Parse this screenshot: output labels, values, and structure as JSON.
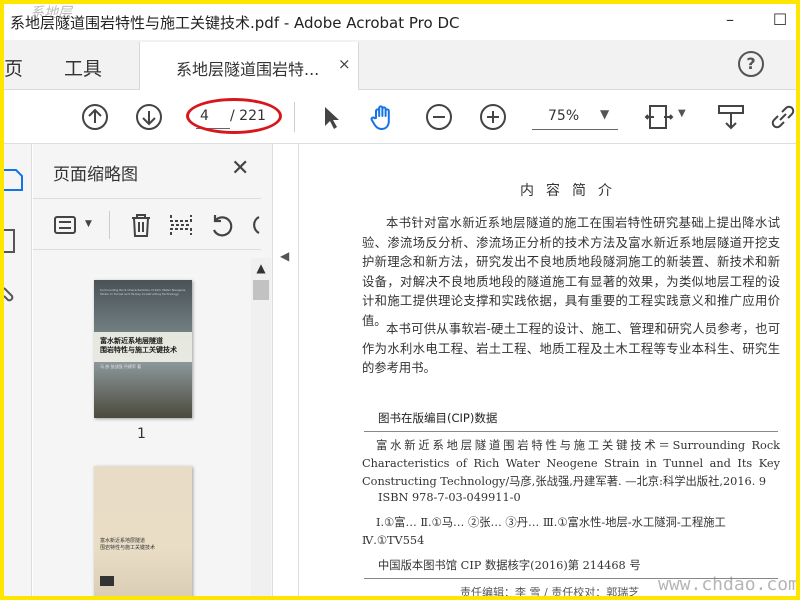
{
  "window": {
    "title": "系地层隧道围岩特性与施工关键技术.pdf - Adobe Acrobat Pro DC",
    "watermark_topleft": "系地层"
  },
  "tabs": {
    "home_partial": "页",
    "tools": "工具",
    "document": "系地层隧道围岩特...",
    "close_symbol": "×",
    "help_symbol": "?"
  },
  "toolbar": {
    "page_current": "4",
    "page_total": "/ 221",
    "zoom": "75%"
  },
  "thumbnail_panel": {
    "title": "页面缩略图",
    "close_symbol": "✕",
    "thumbs": [
      {
        "label": "1",
        "cover_title": "富水新近系地层隧道\n围岩特性与施工关键技术",
        "cover_en": "Surrounding Rock Characteristics of Rich Water Neogene Strain in Tunnel and Its Key Constructing Technology",
        "cover_authors": "马 彦   张战强   丹建军 著"
      },
      {
        "label": "",
        "cover_title": "富水新近系地层隧道\n围岩特性与施工关键技术"
      }
    ]
  },
  "document": {
    "heading": "内容简介",
    "para1": "本书针对富水新近系地层隧道的施工在围岩特性研究基础上提出降水试验、渗流场反分析、渗流场正分析的技术方法及富水新近系地层隧道开挖支护新理念和新方法，研究发出不良地质地段隧洞施工的新装置、新技术和新设备，对解决不良地质地段的隧道施工有显著的效果，为类似地层工程的设计和施工提供理论支撑和实践依据，具有重要的工程实践意义和推广应用价值。",
    "para2": "本书可供从事软岩-硬土工程的设计、施工、管理和研究人员参考，也可作为水利水电工程、岩土工程、地质工程及土木工程等专业本科生、研究生的参考用书。",
    "cip_title": "图书在版编目(CIP)数据",
    "cip_body": "富水新近系地层隧道围岩特性与施工关键技术＝Surrounding Rock Characteristics of Rich Water Neogene Strain in Tunnel and Its Key Constructing Technology/马彦,张战强,丹建军著. —北京:科学出版社,2016. 9",
    "cip_isbn": "ISBN 978-7-03-049911-0",
    "cip_class": "Ⅰ.①富…  Ⅱ.①马…  ②张…  ③丹…   Ⅲ.①富水性-地层-水工隧洞-工程施工   Ⅳ.①TV554",
    "cip_data": "中国版本图书馆 CIP 数据核字(2016)第 214468 号",
    "editors": "责任编辑：李  雪 / 责任校对：郭瑞芝",
    "watermark": "www.chdao.com"
  },
  "colors": {
    "frame": "#ffe600",
    "annotation_oval": "#d8161c"
  },
  "icons": [
    "page-up-icon",
    "page-down-icon",
    "select-arrow-icon",
    "hand-tool-icon",
    "zoom-out-icon",
    "zoom-in-icon",
    "fit-page-icon",
    "scroll-mode-icon",
    "link-icon",
    "options-icon",
    "delete-icon",
    "insert-pages-icon",
    "undo-icon",
    "redo-icon"
  ]
}
